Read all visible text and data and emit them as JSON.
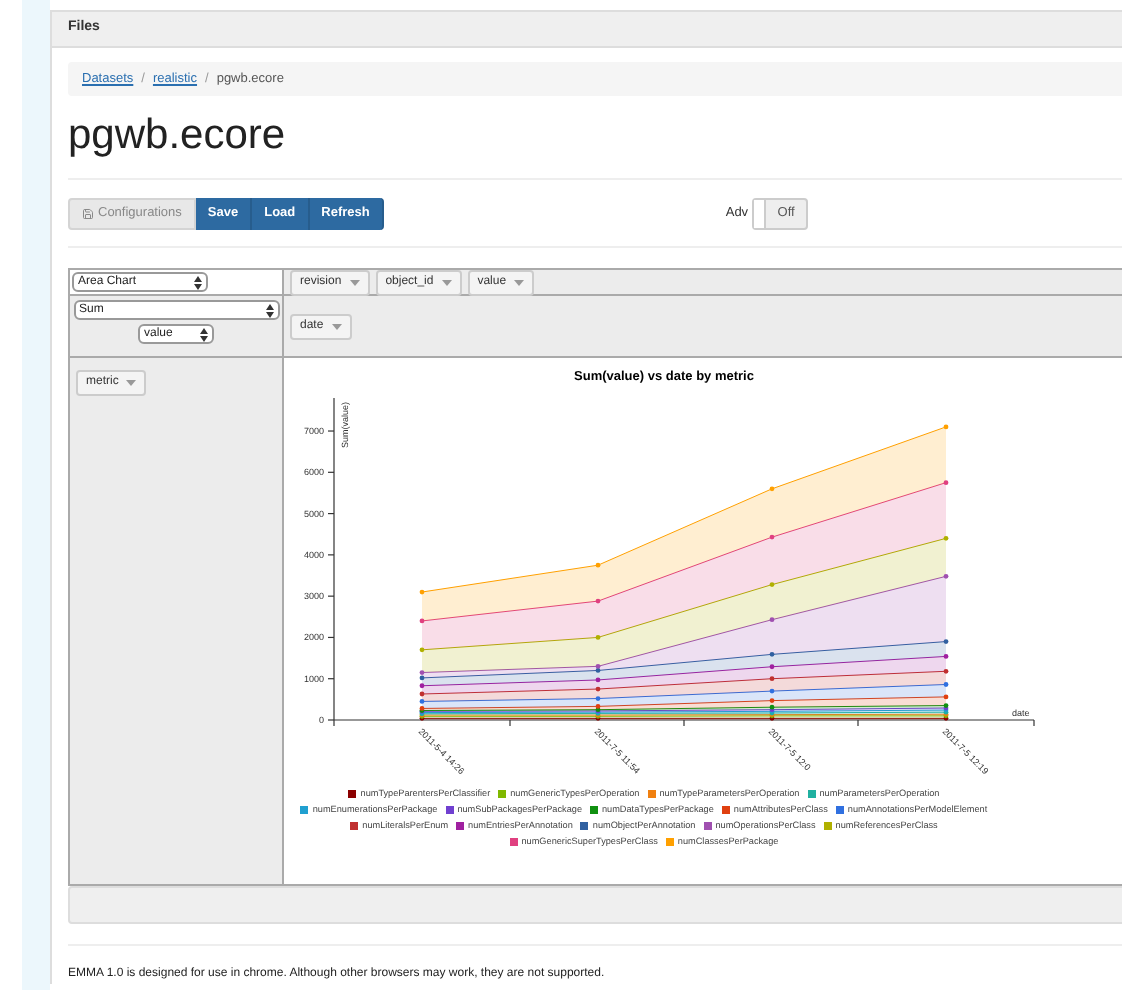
{
  "panel": {
    "title": "Files"
  },
  "breadcrumb": {
    "separator": "/",
    "items": [
      {
        "label": "Datasets",
        "link": true
      },
      {
        "label": "realistic",
        "link": true
      },
      {
        "label": "pgwb.ecore",
        "link": false
      }
    ]
  },
  "page_title": "pgwb.ecore",
  "toolbar": {
    "buttons": [
      {
        "label": "Configurations",
        "kind": "default"
      },
      {
        "label": "Save",
        "kind": "primary"
      },
      {
        "label": "Load",
        "kind": "primary"
      },
      {
        "label": "Refresh",
        "kind": "primary"
      }
    ],
    "toggle": {
      "label": "Adv",
      "text": "Off",
      "on": false
    }
  },
  "pivot": {
    "renderer": "Area Chart",
    "aggregator": "Sum",
    "aggregator_field": "value",
    "unused_attributes": [
      "revision",
      "object_id",
      "value"
    ],
    "column_attributes": [
      "date"
    ],
    "row_attributes": [
      "metric"
    ],
    "chart_data": {
      "type": "area",
      "stacked": true,
      "title": "Sum(value) vs date by metric",
      "xlabel": "date",
      "ylabel": "Sum(value)",
      "categories": [
        "2011-5-4 14:26",
        "2011-7-5 11:54",
        "2011-7-5 12:0",
        "2011-7-5 12:19"
      ],
      "ylim": [
        0,
        7800
      ],
      "yticks": [
        0,
        1000,
        2000,
        3000,
        4000,
        5000,
        6000,
        7000
      ],
      "series": [
        {
          "name": "numTypeParentersPerClassifier",
          "color": "#8b0000",
          "values": [
            40,
            40,
            40,
            40
          ]
        },
        {
          "name": "numGenericTypesPerOperation",
          "color": "#7fb800",
          "values": [
            50,
            50,
            60,
            60
          ]
        },
        {
          "name": "numTypeParametersPerOperation",
          "color": "#f08010",
          "values": [
            30,
            30,
            30,
            40
          ]
        },
        {
          "name": "numParametersPerOperation",
          "color": "#20b0a0",
          "values": [
            30,
            40,
            40,
            50
          ]
        },
        {
          "name": "numEnumerationsPerPackage",
          "color": "#20a0d0",
          "values": [
            30,
            30,
            40,
            50
          ]
        },
        {
          "name": "numSubPackagesPerPackage",
          "color": "#7040d0",
          "values": [
            30,
            30,
            40,
            50
          ]
        },
        {
          "name": "numDataTypesPerPackage",
          "color": "#109010",
          "values": [
            20,
            30,
            60,
            60
          ]
        },
        {
          "name": "numAttributesPerClass",
          "color": "#e04010",
          "values": [
            50,
            80,
            160,
            210
          ]
        },
        {
          "name": "numAnnotationsPerModelElement",
          "color": "#3070e0",
          "values": [
            170,
            190,
            230,
            300
          ]
        },
        {
          "name": "numLiteralsPerEnum",
          "color": "#c03030",
          "values": [
            180,
            230,
            300,
            320
          ]
        },
        {
          "name": "numEntriesPerAnnotation",
          "color": "#a020a0",
          "values": [
            200,
            220,
            290,
            360
          ]
        },
        {
          "name": "numObjectPerAnnotation",
          "color": "#3060a0",
          "values": [
            190,
            230,
            300,
            360
          ]
        },
        {
          "name": "numOperationsPerClass",
          "color": "#a050b0",
          "values": [
            130,
            100,
            840,
            1580
          ]
        },
        {
          "name": "numReferencesPerClass",
          "color": "#b0b000",
          "values": [
            550,
            700,
            850,
            920
          ]
        },
        {
          "name": "numGenericSuperTypesPerClass",
          "color": "#e04080",
          "values": [
            700,
            880,
            1150,
            1350
          ]
        },
        {
          "name": "numClassesPerPackage",
          "color": "#ffa000",
          "values": [
            700,
            870,
            1170,
            1350
          ]
        }
      ]
    }
  },
  "footer": "EMMA 1.0 is designed for use in chrome. Although other browsers may work, they are not supported."
}
